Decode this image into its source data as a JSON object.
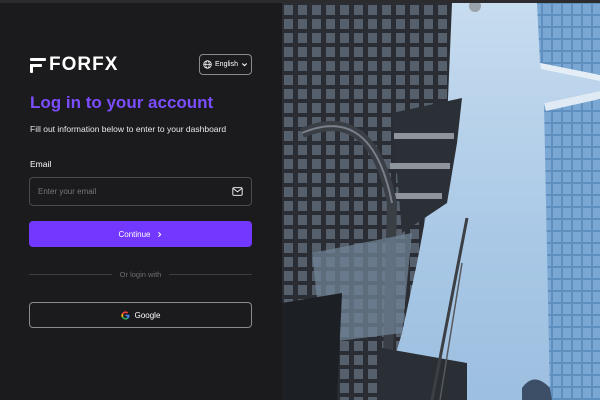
{
  "brand": {
    "name": "FORFX"
  },
  "language": {
    "selected": "English"
  },
  "heading": {
    "title": "Log in to your account",
    "subtitle": "Fill out information below to enter to your dashboard"
  },
  "email": {
    "label": "Email",
    "placeholder": "Enter your email",
    "value": ""
  },
  "continue": {
    "label": "Continue"
  },
  "divider": {
    "label": "Or login with"
  },
  "google": {
    "label": "Google"
  },
  "colors": {
    "accent": "#7338ff",
    "title": "#7c4dff",
    "panel": "#1b1b1d",
    "sky": "#a9c8e6"
  },
  "icons": [
    "globe-icon",
    "chevron-down-icon",
    "mail-icon",
    "chevron-right-icon",
    "google-icon"
  ]
}
